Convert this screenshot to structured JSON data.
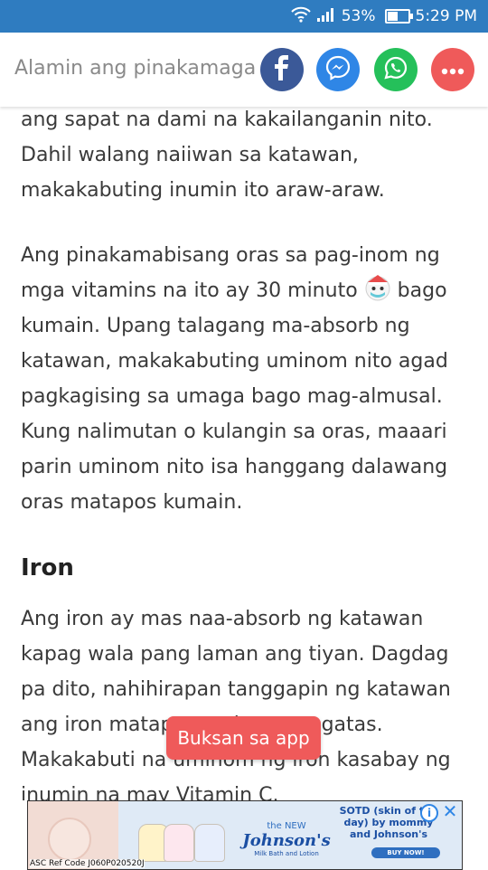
{
  "status_bar": {
    "battery": "53%",
    "time": "5:29 PM",
    "battery_level": 0.53,
    "icons": [
      "wifi-icon",
      "signal-icon",
      "battery-icon"
    ]
  },
  "header": {
    "title": "Alamin ang pinakamaga",
    "share_buttons": [
      {
        "name": "facebook-share-button",
        "icon": "facebook-icon",
        "color": "#3b5998"
      },
      {
        "name": "messenger-share-button",
        "icon": "messenger-icon",
        "color": "#2f86e6"
      },
      {
        "name": "whatsapp-share-button",
        "icon": "whatsapp-icon",
        "color": "#25c05a"
      },
      {
        "name": "more-share-button",
        "icon": "more-icon",
        "color": "#ef5a5a"
      }
    ]
  },
  "article": {
    "p1": "ng katawan. Kinukuha lamang ng katawan ang sapat na dami na kakailanganin nito. Dahil walang naiiwan sa katawan, makakabuting inumin ito araw-araw.",
    "p2_before": "Ang pinakamabisang oras sa pag-inom ng mga vitamins na ito ay 30 minuto",
    "p2_after": "bago kumain. Upang talagang ma-absorb ng katawan, makakabuting uminom nito agad pagkagising sa umaga bago mag-almusal. Kung nalimutan o kulangin sa oras, maaari parin uminom nito isa hanggang dalawang oras matapos kumain.",
    "heading": "Iron",
    "p3": "Ang iron ay mas naa-absorb ng katawan kapag wala pang laman ang tiyan. Dagdag pa dito, nahihirapan tanggapin ng katawan ang iron matapos uminom ng gatas. Makakabuti na uminom ng iron kasabay ng inumin na may Vitamin C."
  },
  "open_app": {
    "label": "Buksan sa app"
  },
  "ad": {
    "ref_code": "ASC Ref Code J060P020520J",
    "brand_new": "the NEW",
    "brand_name": "Johnson's",
    "brand_sub": "Milk Bath and Lotion",
    "headline": "SOTD (skin of the day) by mommy and Johnson's",
    "buy_label": "BUY NOW!",
    "info_label": "i",
    "close_label": "✕"
  }
}
